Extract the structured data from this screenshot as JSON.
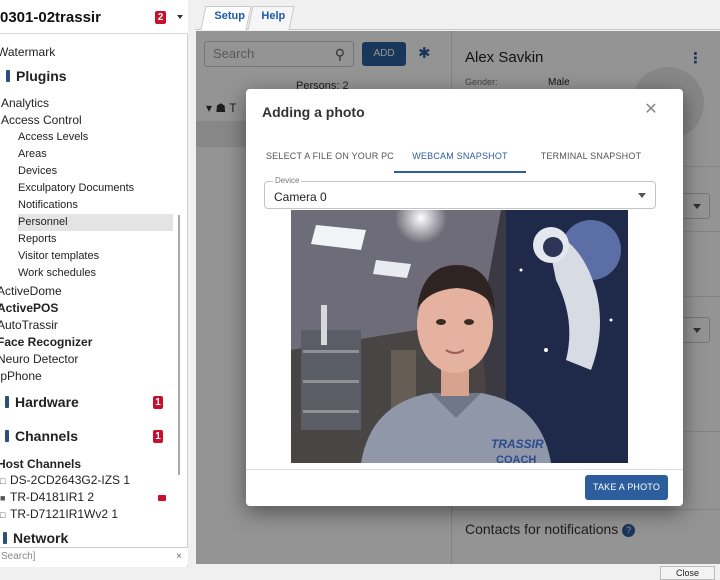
{
  "server": {
    "name": "0301-02trassir",
    "badge": "2"
  },
  "tree": {
    "watermark": "Watermark",
    "plugins": "Plugins",
    "analytics": "Analytics",
    "access_control": "Access Control",
    "ac_items": [
      "Access Levels",
      "Areas",
      "Devices",
      "Exculpatory Documents",
      "Notifications",
      "Personnel",
      "Reports",
      "Visitor templates",
      "Work schedules"
    ],
    "active_dome": "ActiveDome",
    "active_pos": "ActivePOS",
    "auto_trassir": "AutoTrassir",
    "face_recognizer": "Face Recognizer",
    "neuro_detector": "Neuro Detector",
    "ip_phone": "IpPhone",
    "hardware": "Hardware",
    "hardware_badge": "1",
    "channels": "Channels",
    "channels_badge": "1",
    "host_channels": "Host Channels",
    "cameras": [
      "DS-2CD2643G2-IZS 1",
      "TR-D4181IR1 2",
      "TR-D7121IR1Wv2 1"
    ],
    "network": "Network"
  },
  "search": {
    "placeholder": "Search]",
    "clear": "×"
  },
  "tabs": {
    "setup": "Setup",
    "help": "Help"
  },
  "background": {
    "search_placeholder": "Search",
    "add_label": "ADD",
    "persons_count": "Persons: 2",
    "person_name": "Alex Savkin",
    "gender_label": "Gender:",
    "gender_value": "Male",
    "contacts": "Contacts for notifications"
  },
  "modal": {
    "title": "Adding a photo",
    "tabs": [
      "SELECT A FILE ON YOUR PC",
      "WEBCAM SNAPSHOT",
      "TERMINAL SNAPSHOT"
    ],
    "active_tab": "WEBCAM SNAPSHOT",
    "device_label": "Device",
    "device_value": "Camera 0",
    "take_photo": "TAKE A PHOTO",
    "webcam_text": "TRASSIR\nCOACH"
  },
  "window": {
    "close_label": "Close"
  },
  "colors": {
    "accent": "#2c5e9e",
    "badge": "#c8102e"
  }
}
